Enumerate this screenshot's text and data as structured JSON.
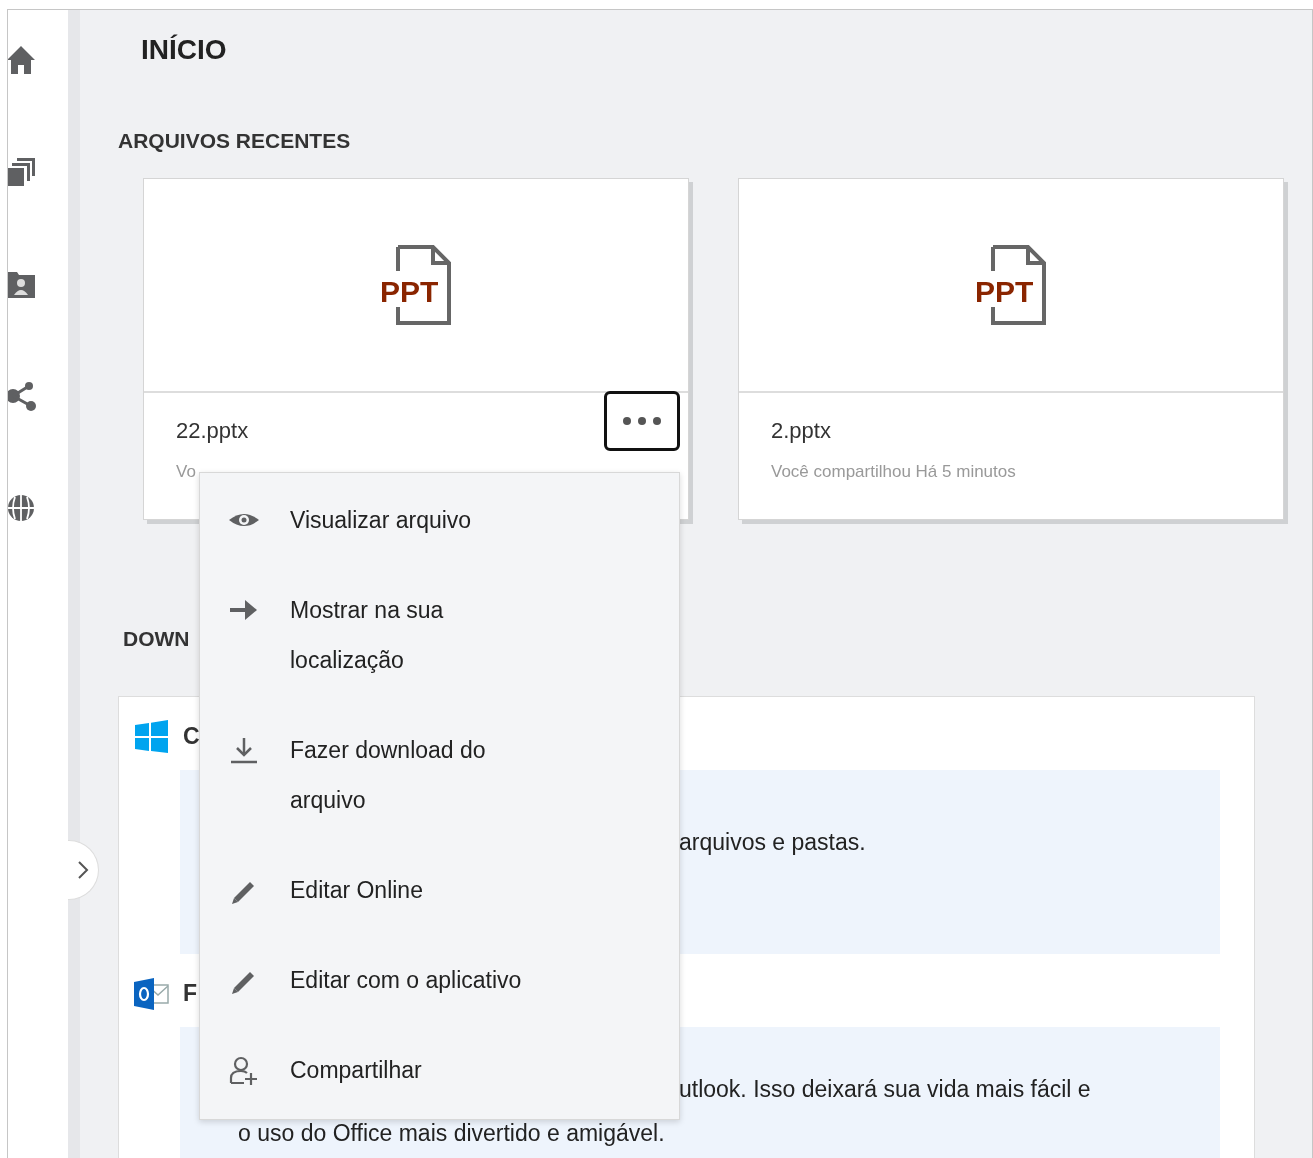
{
  "page": {
    "title": "INÍCIO"
  },
  "recent_files": {
    "heading": "ARQUIVOS RECENTES",
    "files": [
      {
        "type_label": "PPT",
        "name": "22.pptx",
        "detail": "Vo",
        "menu_open": true
      },
      {
        "type_label": "PPT",
        "name": "2.pptx",
        "detail": "Você compartilhou Há 5 minutos",
        "menu_open": false
      }
    ]
  },
  "context_menu": {
    "items": [
      {
        "kind": "view",
        "label": "Visualizar arquivo"
      },
      {
        "kind": "locate",
        "label": "Mostrar na sua localização"
      },
      {
        "kind": "download",
        "label": "Fazer download do arquivo"
      },
      {
        "kind": "edit",
        "label": "Editar Online"
      },
      {
        "kind": "edit",
        "label": "Editar com o aplicativo"
      },
      {
        "kind": "share",
        "label": "Compartilhar"
      }
    ]
  },
  "downloads": {
    "heading": "DOWN",
    "sections": [
      {
        "kind": "windows",
        "title": "C",
        "lines": [
          "arquivos e pastas."
        ]
      },
      {
        "kind": "outlook",
        "title": "F",
        "lines": [
          "utlook. Isso deixará sua vida mais fácil e",
          "o uso do Office mais divertido e amigável."
        ]
      }
    ]
  }
}
